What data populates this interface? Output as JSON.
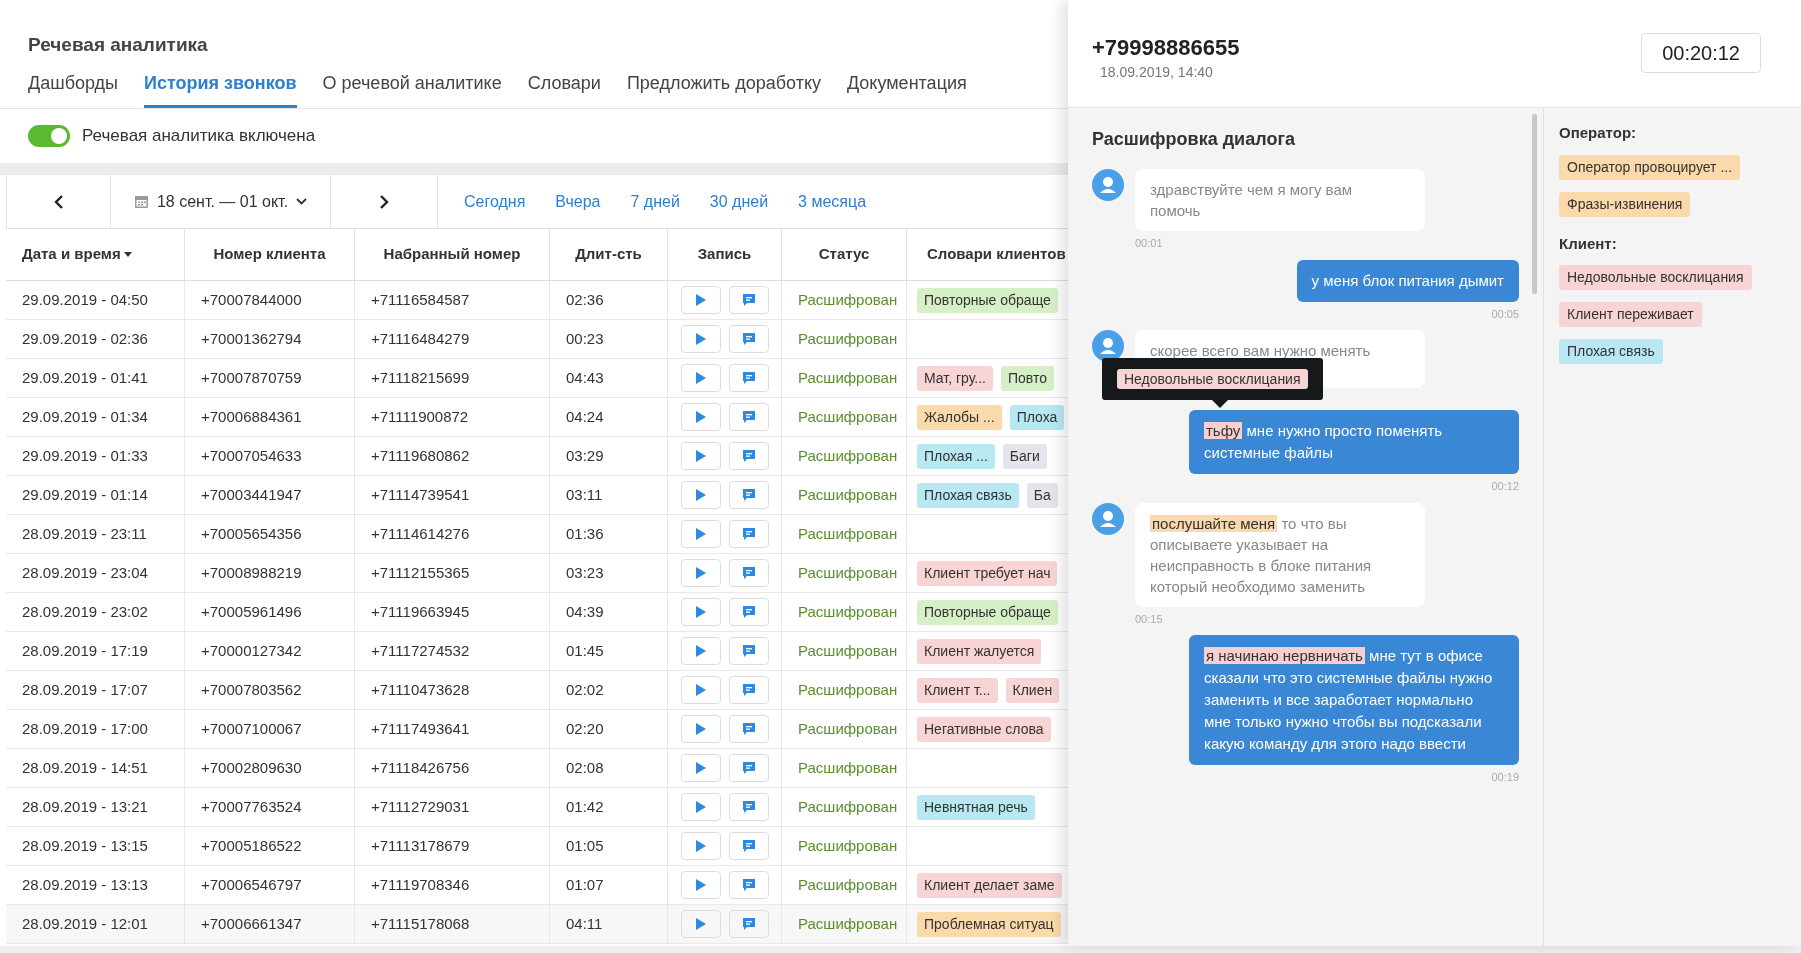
{
  "app_title": "Речевая аналитика",
  "tabs": [
    {
      "label": "Дашборды",
      "selected": false
    },
    {
      "label": "История звонков",
      "selected": true
    },
    {
      "label": "О речевой аналитике",
      "selected": false
    },
    {
      "label": "Словари",
      "selected": false
    },
    {
      "label": "Предложить доработку",
      "selected": false
    },
    {
      "label": "Документация",
      "selected": false
    }
  ],
  "toggle": {
    "label": "Речевая аналитика включена",
    "on": true
  },
  "date_range": {
    "value": "18 сент. — 01 окт."
  },
  "periods": [
    {
      "label": "Сегодня",
      "selected": false
    },
    {
      "label": "Вчера",
      "selected": false
    },
    {
      "label": "7 дней",
      "selected": false
    },
    {
      "label": "30 дней",
      "selected": false
    },
    {
      "label": "3 месяца",
      "selected": false
    }
  ],
  "table": {
    "columns": [
      {
        "label": "Дата и время",
        "sorted": true
      },
      {
        "label": "Номер клиента"
      },
      {
        "label": "Набранный номер"
      },
      {
        "label": "Длит-сть"
      },
      {
        "label": "Запись"
      },
      {
        "label": "Статус"
      },
      {
        "label": "Словари клиентов"
      }
    ],
    "rows": [
      {
        "datetime": "29.09.2019 - 04:50",
        "client": "+70007844000",
        "dialed": "+71116584587",
        "duration": "02:36",
        "status": "Расшифрован",
        "tags": [
          {
            "text": "Повторные обраще",
            "color": "#d5f0c6"
          }
        ]
      },
      {
        "datetime": "29.09.2019 - 02:36",
        "client": "+70001362794",
        "dialed": "+71116484279",
        "duration": "00:23",
        "status": "Расшифрован",
        "tags": []
      },
      {
        "datetime": "29.09.2019 - 01:41",
        "client": "+70007870759",
        "dialed": "+71118215699",
        "duration": "04:43",
        "status": "Расшифрован",
        "tags": [
          {
            "text": "Мат, гру...",
            "color": "#f8d4d4"
          },
          {
            "text": "Повто",
            "color": "#d5f0c6"
          }
        ]
      },
      {
        "datetime": "29.09.2019 - 01:34",
        "client": "+70006884361",
        "dialed": "+71111900872",
        "duration": "04:24",
        "status": "Расшифрован",
        "tags": [
          {
            "text": "Жалобы ...",
            "color": "#fad9aa"
          },
          {
            "text": "Плоха",
            "color": "#b8e8f2"
          }
        ]
      },
      {
        "datetime": "29.09.2019 - 01:33",
        "client": "+70007054633",
        "dialed": "+71119680862",
        "duration": "03:29",
        "status": "Расшифрован",
        "tags": [
          {
            "text": "Плохая ...",
            "color": "#b8e8f2"
          },
          {
            "text": "Баги",
            "color": "#e4e4ec"
          }
        ]
      },
      {
        "datetime": "29.09.2019 - 01:14",
        "client": "+70003441947",
        "dialed": "+71114739541",
        "duration": "03:11",
        "status": "Расшифрован",
        "tags": [
          {
            "text": "Плохая связь",
            "color": "#b8e8f2"
          },
          {
            "text": "Ба",
            "color": "#e4e4ec"
          }
        ]
      },
      {
        "datetime": "28.09.2019 - 23:11",
        "client": "+70005654356",
        "dialed": "+71114614276",
        "duration": "01:36",
        "status": "Расшифрован",
        "tags": []
      },
      {
        "datetime": "28.09.2019 - 23:04",
        "client": "+70008988219",
        "dialed": "+71112155365",
        "duration": "03:23",
        "status": "Расшифрован",
        "tags": [
          {
            "text": "Клиент требует нач",
            "color": "#f8d4d4"
          }
        ]
      },
      {
        "datetime": "28.09.2019 - 23:02",
        "client": "+70005961496",
        "dialed": "+71119663945",
        "duration": "04:39",
        "status": "Расшифрован",
        "tags": [
          {
            "text": "Повторные обраще",
            "color": "#d5f0c6"
          }
        ]
      },
      {
        "datetime": "28.09.2019 - 17:19",
        "client": "+70000127342",
        "dialed": "+71117274532",
        "duration": "01:45",
        "status": "Расшифрован",
        "tags": [
          {
            "text": "Клиент жалуется",
            "color": "#f8d4d4"
          }
        ]
      },
      {
        "datetime": "28.09.2019 - 17:07",
        "client": "+70007803562",
        "dialed": "+71110473628",
        "duration": "02:02",
        "status": "Расшифрован",
        "tags": [
          {
            "text": "Клиент т...",
            "color": "#f8d4d4"
          },
          {
            "text": "Клиен",
            "color": "#f8d4d4"
          }
        ]
      },
      {
        "datetime": "28.09.2019 - 17:00",
        "client": "+70007100067",
        "dialed": "+71117493641",
        "duration": "02:20",
        "status": "Расшифрован",
        "tags": [
          {
            "text": "Негативные слова",
            "color": "#f8d4d4"
          }
        ]
      },
      {
        "datetime": "28.09.2019 - 14:51",
        "client": "+70002809630",
        "dialed": "+71118426756",
        "duration": "02:08",
        "status": "Расшифрован",
        "tags": []
      },
      {
        "datetime": "28.09.2019 - 13:21",
        "client": "+70007763524",
        "dialed": "+71112729031",
        "duration": "01:42",
        "status": "Расшифрован",
        "tags": [
          {
            "text": "Невнятная речь",
            "color": "#b8e8f2"
          }
        ]
      },
      {
        "datetime": "28.09.2019 - 13:15",
        "client": "+70005186522",
        "dialed": "+71113178679",
        "duration": "01:05",
        "status": "Расшифрован",
        "tags": []
      },
      {
        "datetime": "28.09.2019 - 13:13",
        "client": "+70006546797",
        "dialed": "+71119708346",
        "duration": "01:07",
        "status": "Расшифрован",
        "tags": [
          {
            "text": "Клиент делает заме",
            "color": "#f8d4d4"
          }
        ]
      },
      {
        "datetime": "28.09.2019 - 12:01",
        "client": "+70006661347",
        "dialed": "+71115178068",
        "duration": "04:11",
        "status": "Расшифрован",
        "tags": [
          {
            "text": "Проблемная ситуац",
            "color": "#fad9aa"
          }
        ]
      }
    ]
  },
  "call": {
    "phone": "+79998886655",
    "datetime": "18.09.2019, 14:40",
    "timer": "00:20:12"
  },
  "transcript": {
    "title": "Расшифровка диалога",
    "messages": [
      {
        "kind": "operator",
        "text": "здравствуйте чем я могу вам помочь",
        "time": "00:01"
      },
      {
        "kind": "client",
        "text": "у меня блок питания дымит",
        "time": "00:05"
      },
      {
        "kind": "operator",
        "text": "скорее всего вам нужно менять"
      },
      {
        "kind": "client",
        "highlight": {
          "text": "тьфу",
          "color": "#f8cfcf"
        },
        "text": "мне нужно просто поменять системные файлы",
        "time": "00:12",
        "tooltip": {
          "text": "Недовольные восклицания",
          "color": "#f8d4d4"
        }
      },
      {
        "kind": "operator",
        "highlight": {
          "text": "послушайте меня",
          "color": "#fbd9aa"
        },
        "text": "то что вы описываете указывает на неисправность в блоке питания который необходимо заменить",
        "time": "00:15"
      },
      {
        "kind": "client",
        "highlight": {
          "text": "я начинаю нервничать",
          "color": "#f8cfcf"
        },
        "text": "мне тут в офисе сказали что это системные файлы нужно заменить и все заработает нормально мне только нужно чтобы вы подсказали какую команду для этого надо ввести",
        "time": "00:19"
      }
    ]
  },
  "sidebar": {
    "groups": [
      {
        "title": "Оператор:",
        "tags": [
          {
            "text": "Оператор провоцирует ...",
            "color": "#fad9aa"
          },
          {
            "text": "Фразы-извинения",
            "color": "#fad9aa"
          }
        ]
      },
      {
        "title": "Клиент:",
        "tags": [
          {
            "text": "Недовольные восклицания",
            "color": "#f8d4d4"
          },
          {
            "text": "Клиент переживает",
            "color": "#f8d4d4"
          },
          {
            "text": "Плохая связь",
            "color": "#b8e8f2"
          }
        ]
      }
    ]
  }
}
